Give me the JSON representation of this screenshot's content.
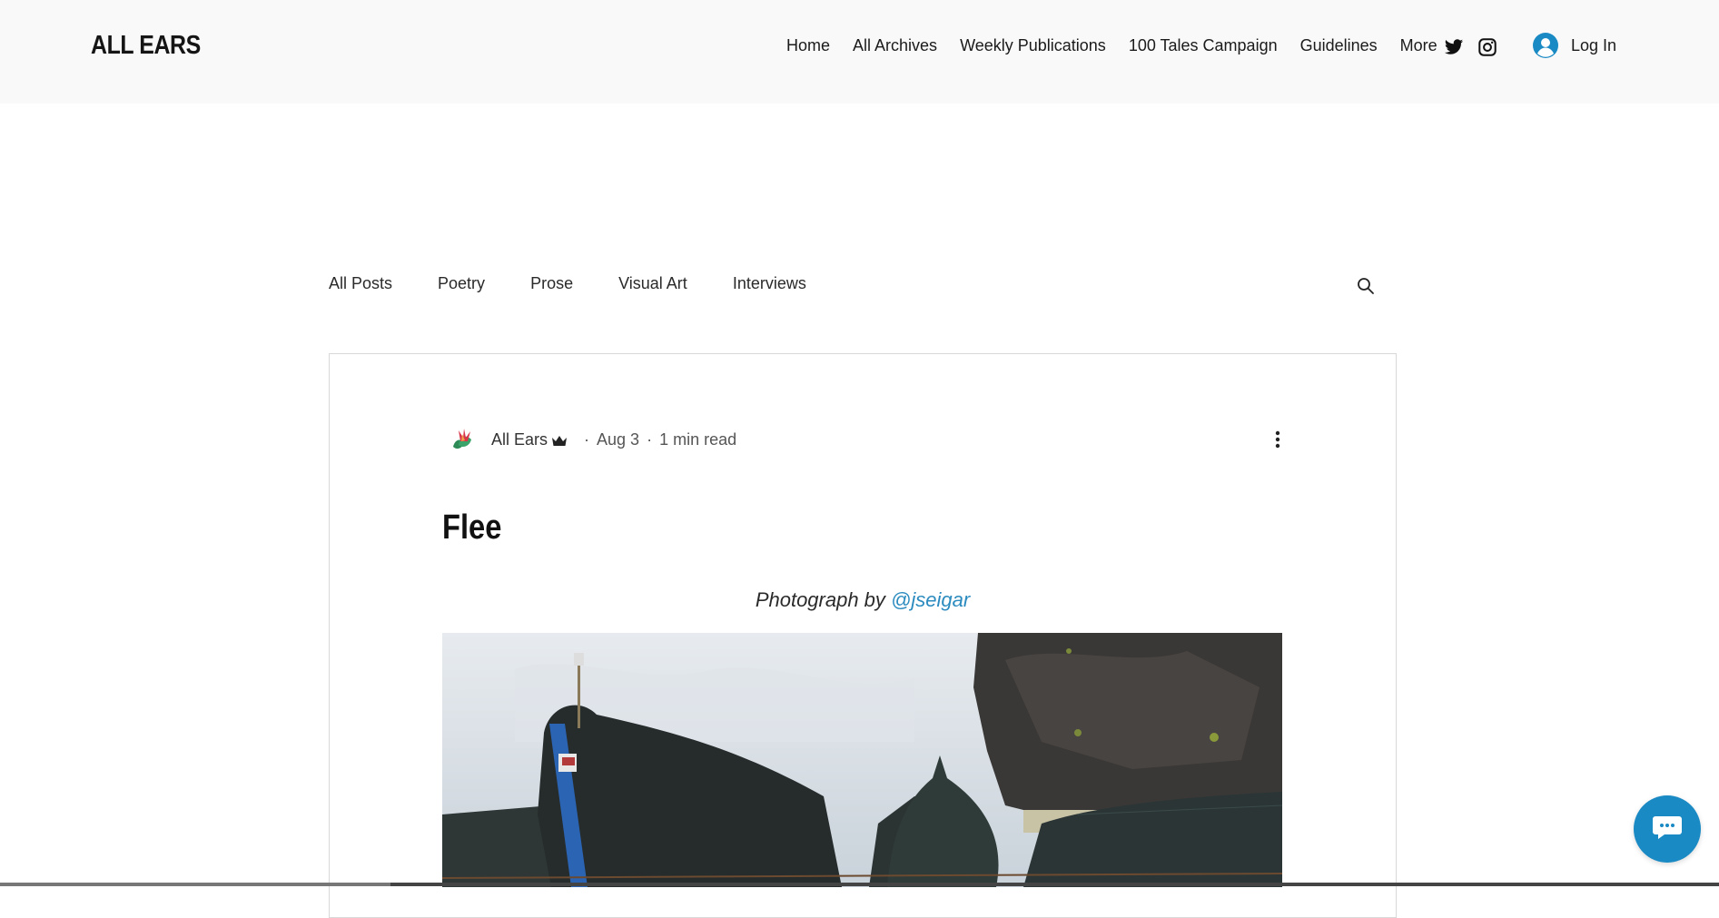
{
  "header": {
    "logo": "ALL EARS",
    "nav": [
      "Home",
      "All Archives",
      "Weekly Publications",
      "100 Tales Campaign",
      "Guidelines",
      "More"
    ],
    "social_icons": [
      "twitter-icon",
      "instagram-icon"
    ],
    "login_label": "Log In"
  },
  "blog_nav": {
    "categories": [
      "All Posts",
      "Poetry",
      "Prose",
      "Visual Art",
      "Interviews"
    ]
  },
  "post": {
    "author": "All Ears",
    "date": "Aug 3",
    "read_time": "1 min read",
    "title": "Flee",
    "caption_prefix": "Photograph by",
    "caption_handle": "@jseigar"
  },
  "colors": {
    "accent": "#1a8ac4",
    "link": "#2b8bbf",
    "header_bg": "#f9f9f9"
  }
}
